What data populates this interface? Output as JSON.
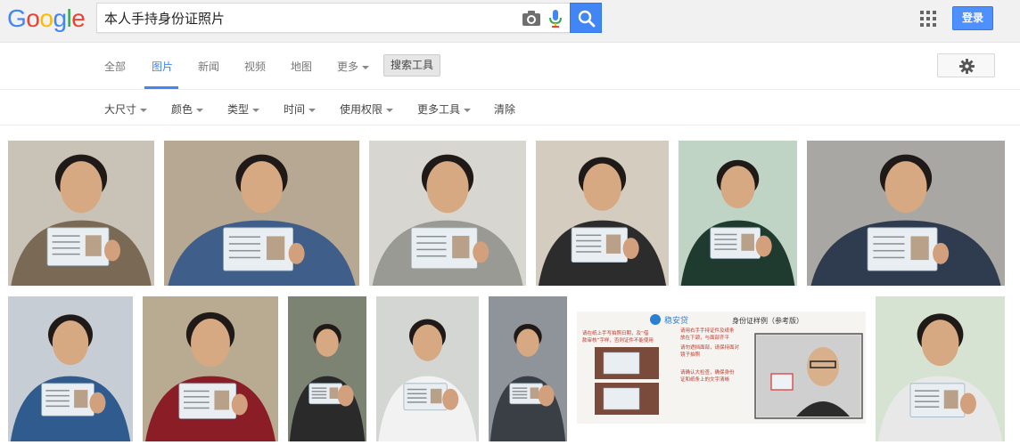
{
  "logo": {
    "letters": [
      "G",
      "o",
      "o",
      "g",
      "l",
      "e"
    ],
    "colors": [
      "#4285f4",
      "#ea4335",
      "#fbbc05",
      "#4285f4",
      "#34a853",
      "#ea4335"
    ]
  },
  "search": {
    "query": "本人手持身份证照片"
  },
  "header": {
    "signin_label": "登录"
  },
  "tabs": [
    {
      "label": "全部",
      "active": false
    },
    {
      "label": "图片",
      "active": true
    },
    {
      "label": "新闻",
      "active": false
    },
    {
      "label": "视频",
      "active": false
    },
    {
      "label": "地图",
      "active": false
    },
    {
      "label": "更多",
      "active": false
    }
  ],
  "search_tools_label": "搜索工具",
  "tools": [
    {
      "label": "大尺寸"
    },
    {
      "label": "颜色"
    },
    {
      "label": "类型"
    },
    {
      "label": "时间"
    },
    {
      "label": "使用权限"
    },
    {
      "label": "更多工具"
    },
    {
      "label": "清除"
    }
  ],
  "results": {
    "row1": [
      {
        "bg": "#c9c2b6",
        "shirt": "#7a6a55"
      },
      {
        "bg": "#b7a893",
        "shirt": "#3f5e8a"
      },
      {
        "bg": "#d8d6d0",
        "shirt": "#9a9a94"
      },
      {
        "bg": "#d3ccbf",
        "shirt": "#2c2c2c"
      },
      {
        "bg": "#bfd4c4",
        "shirt": "#1f3a2e"
      },
      {
        "bg": "#a9a7a3",
        "shirt": "#2f3b4f"
      }
    ],
    "row2": [
      {
        "bg": "#c7cdd4",
        "shirt": "#2f5b8f"
      },
      {
        "bg": "#b9aa92",
        "shirt": "#8a1d25"
      },
      {
        "bg": "#7d8372",
        "shirt": "#2a2a2a"
      },
      {
        "bg": "#d4d6d3",
        "shirt": "#f2f2f2"
      },
      {
        "bg": "#8f949a",
        "shirt": "#3a3f45"
      },
      {
        "bg": "#f3f2ef",
        "shirt": "#2b2b2b"
      },
      {
        "bg": "#d7e3d2",
        "shirt": "#e8e8e8"
      }
    ],
    "doc_texts": {
      "brand": "稳安贷",
      "title": "身份证样例（参考版）",
      "left_lines": [
        "请在纸上手写拍照日期，及“借",
        "款审核”字样，否则证件不能使用"
      ],
      "right_lines": [
        "请用右手手持证件及纸条",
        "放在下颌，与面部齐平",
        "请勿遮挡面部，请保持面对",
        "镜子拍照",
        "请确认大检查，确保身份",
        "证和纸条上的文字清晰"
      ]
    }
  }
}
